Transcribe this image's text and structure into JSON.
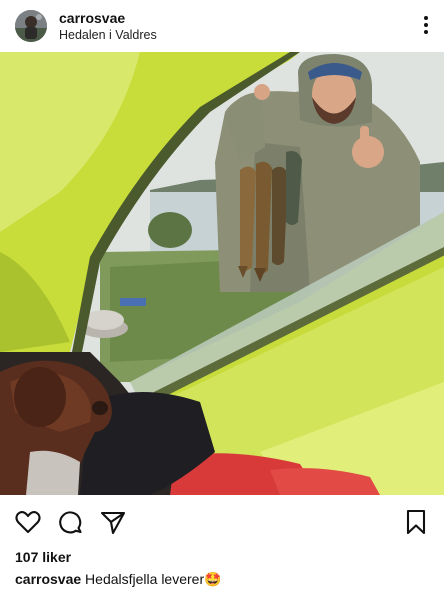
{
  "post": {
    "username": "carrosvae",
    "location": "Hedalen i Valdres",
    "likes_text": "107 liker",
    "caption_user": "carrosvae",
    "caption_text": " Hedalsfjella leverer🤩"
  },
  "icons": {
    "more": "more-vertical-icon",
    "like": "heart-outline-icon",
    "comment": "comment-bubble-icon",
    "share": "paper-plane-icon",
    "save": "bookmark-outline-icon"
  },
  "colors": {
    "text": "#111111",
    "background": "#ffffff"
  }
}
